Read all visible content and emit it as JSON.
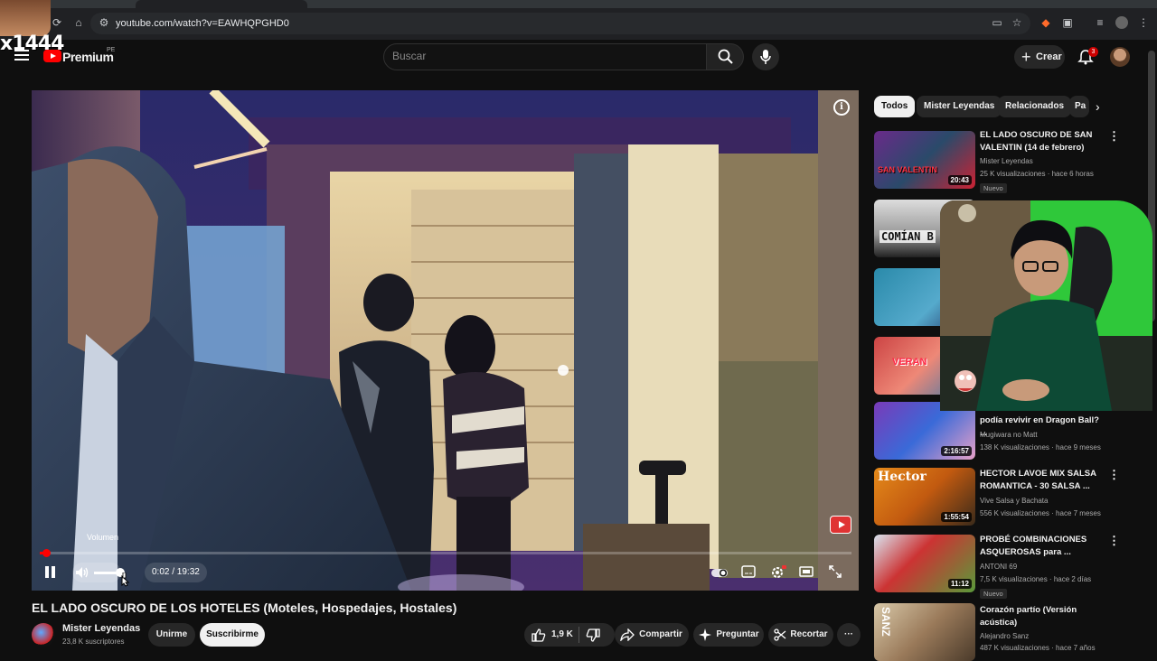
{
  "browser": {
    "url": "youtube.com/watch?v=EAWHQPGHD0"
  },
  "overlay": {
    "watermark": "x1444"
  },
  "header": {
    "logo_text": "Premium",
    "region": "PE",
    "search_placeholder": "Buscar",
    "create_label": "Crear",
    "notification_count": "3"
  },
  "player": {
    "tooltip": "Volumen",
    "time": "0:02 / 19:32",
    "progress_fraction": 0.002,
    "volume_fraction": 0.85
  },
  "video": {
    "title": "EL LADO OSCURO DE LOS HOTELES (Moteles, Hospedajes, Hostales)",
    "channel": "Mister Leyendas",
    "subscribers": "23,8 K suscriptores",
    "join_label": "Unirme",
    "subscribe_label": "Suscribirme",
    "likes": "1,9 K",
    "share_label": "Compartir",
    "ask_label": "Preguntar",
    "clip_label": "Recortar"
  },
  "sidebar": {
    "chips": [
      "Todos",
      "Mister Leyendas",
      "Relacionados",
      "Pa"
    ],
    "recommendations": [
      {
        "title": "EL LADO OSCURO DE SAN VALENTIN (14 de febrero)",
        "channel": "Mister Leyendas",
        "meta": "25 K visualizaciones · hace 6 horas",
        "duration": "20:43",
        "badge": "Nuevo",
        "thumb_text": "SAN VALENTIN"
      },
      {
        "thumb_text": "COMÍAN B"
      },
      {},
      {
        "thumb_text": "VERAN"
      },
      {
        "title": "podía revivir en Dragon Ball? ...",
        "channel": "Mugiwara no Matt",
        "meta": "138 K visualizaciones · hace 9 meses",
        "duration": "2:16:57"
      },
      {
        "title": "HECTOR LAVOE MIX SALSA ROMANTICA - 30 SALSA ...",
        "channel": "Vive Salsa y Bachata",
        "meta": "556 K visualizaciones · hace 7 meses",
        "duration": "1:55:54",
        "thumb_text": "Hector"
      },
      {
        "title": "PROBÉ COMBINACIONES ASQUEROSAS para ...",
        "channel": "ANTONI 69",
        "meta": "7,5 K visualizaciones · hace 2 días",
        "duration": "11:12",
        "badge": "Nuevo"
      },
      {
        "title": "Corazón partío (Versión acústica)",
        "channel": "Alejandro Sanz",
        "meta": "487 K visualizaciones · hace 7 años",
        "thumb_text": "SANZ"
      }
    ]
  },
  "colors": {
    "background": "#0f0f0f",
    "brand_red": "#ff0000",
    "chip_active": "#f1f1f1",
    "webcam_green": "#2fc83a"
  }
}
